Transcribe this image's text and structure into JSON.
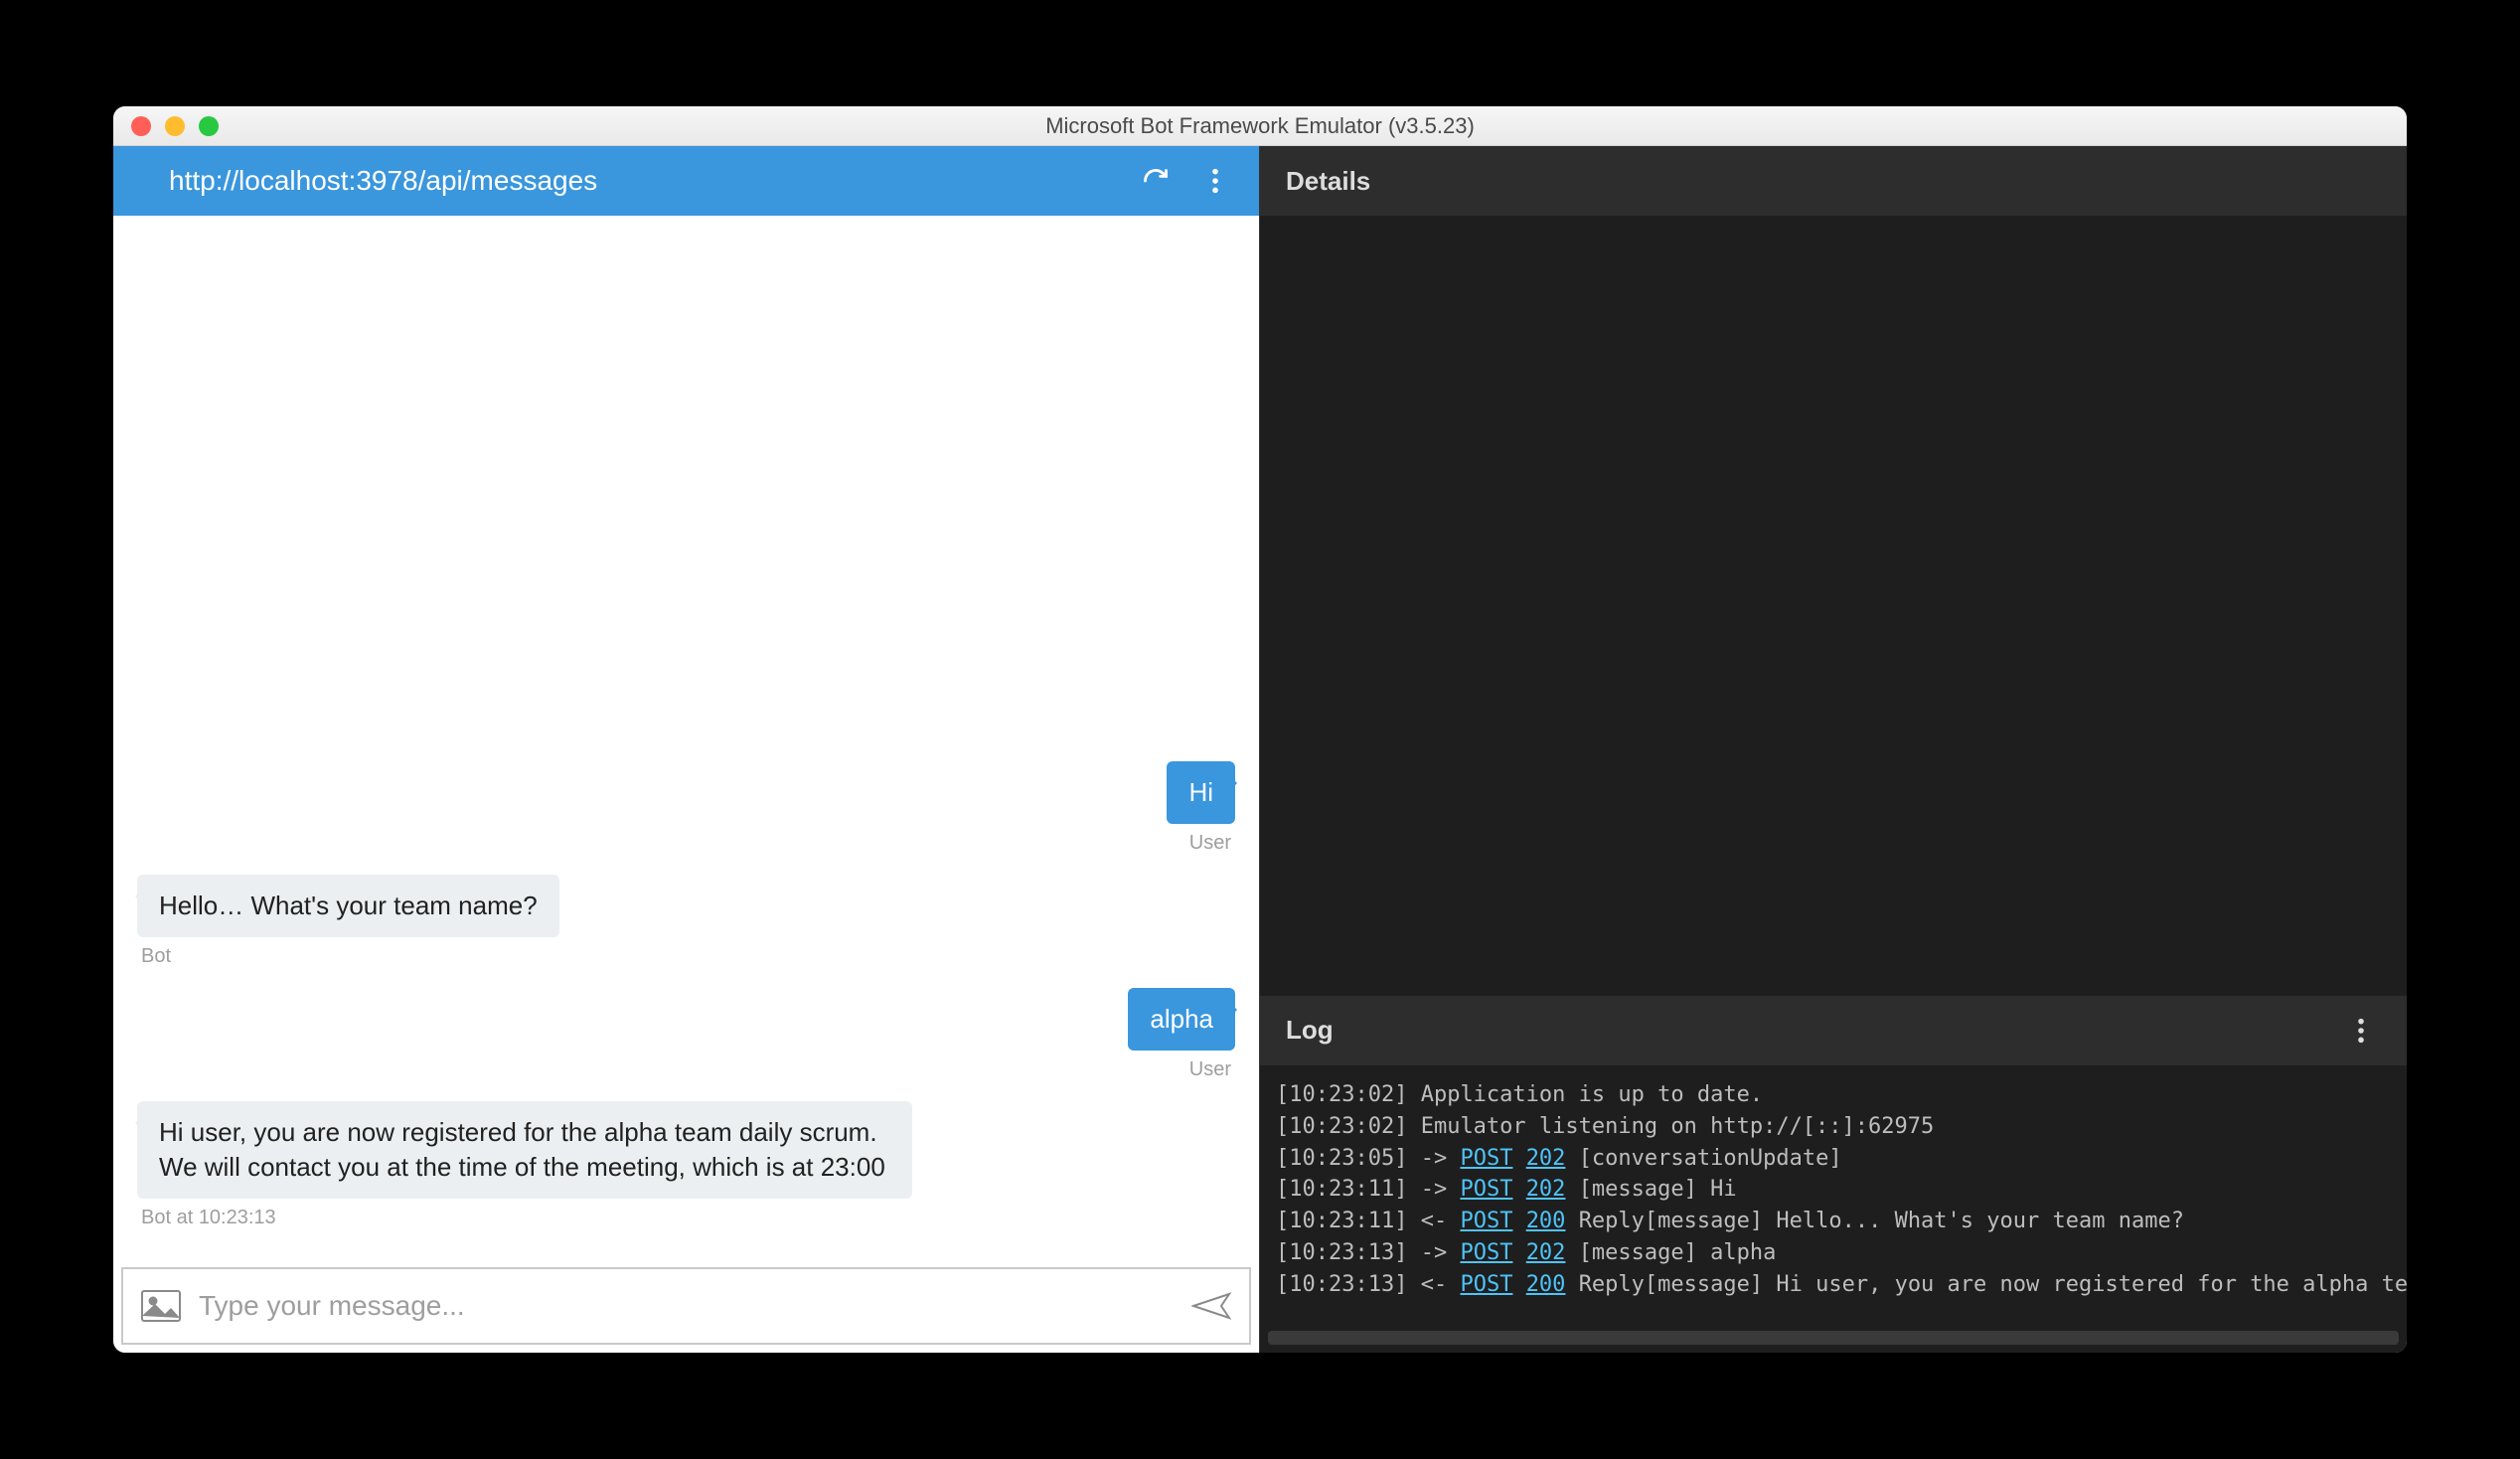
{
  "window": {
    "title": "Microsoft Bot Framework Emulator (v3.5.23)"
  },
  "addressbar": {
    "url": "http://localhost:3978/api/messages"
  },
  "chat": {
    "messages": [
      {
        "side": "user",
        "text": "Hi",
        "meta": "User"
      },
      {
        "side": "bot",
        "text": "Hello… What's your team name?",
        "meta": "Bot"
      },
      {
        "side": "user",
        "text": "alpha",
        "meta": "User"
      },
      {
        "side": "bot",
        "text": "Hi user, you are now registered for the alpha team daily scrum. We will contact you at the time of the meeting, which is at 23:00",
        "meta": "Bot at 10:23:13"
      }
    ],
    "composer_placeholder": "Type your message..."
  },
  "details": {
    "title": "Details"
  },
  "log": {
    "title": "Log",
    "lines": [
      {
        "ts": "[10:23:02]",
        "arrow": "",
        "method": "",
        "status": "",
        "rest": "Application is up to date."
      },
      {
        "ts": "[10:23:02]",
        "arrow": "",
        "method": "",
        "status": "",
        "rest": "Emulator listening on http://[::]:62975"
      },
      {
        "ts": "[10:23:05]",
        "arrow": "->",
        "method": "POST",
        "status": "202",
        "rest": "[conversationUpdate]"
      },
      {
        "ts": "[10:23:11]",
        "arrow": "->",
        "method": "POST",
        "status": "202",
        "rest": "[message] Hi"
      },
      {
        "ts": "[10:23:11]",
        "arrow": "<-",
        "method": "POST",
        "status": "200",
        "rest": "Reply[message] Hello... What's your team name?"
      },
      {
        "ts": "[10:23:13]",
        "arrow": "->",
        "method": "POST",
        "status": "202",
        "rest": "[message] alpha"
      },
      {
        "ts": "[10:23:13]",
        "arrow": "<-",
        "method": "POST",
        "status": "200",
        "rest": "Reply[message] Hi user, you are now registered for the alpha team."
      }
    ]
  }
}
